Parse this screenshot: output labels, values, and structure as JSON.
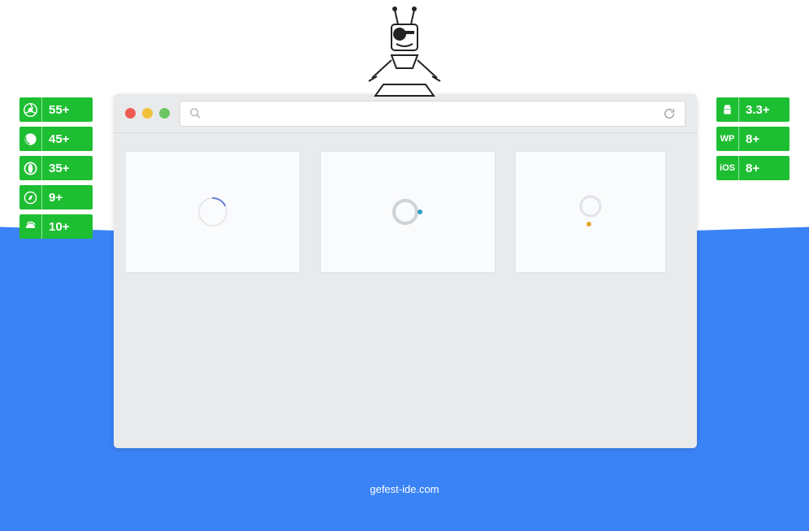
{
  "badges_left": [
    {
      "icon": "chrome",
      "ver": "55+"
    },
    {
      "icon": "firefox",
      "ver": "45+"
    },
    {
      "icon": "opera",
      "ver": "35+"
    },
    {
      "icon": "safari",
      "ver": "9+"
    },
    {
      "icon": "ie",
      "ver": "10+"
    }
  ],
  "badges_right": [
    {
      "icon": "android",
      "ver": "3.3+"
    },
    {
      "icon": "wp",
      "label": "WP",
      "ver": "8+"
    },
    {
      "icon": "ios",
      "label": "iOS",
      "ver": "8+"
    }
  ],
  "addressbar": {
    "value": "",
    "placeholder": ""
  },
  "footer": "gefest-ide.com",
  "colors": {
    "green": "#1ebe32",
    "blue": "#3a83f6"
  }
}
